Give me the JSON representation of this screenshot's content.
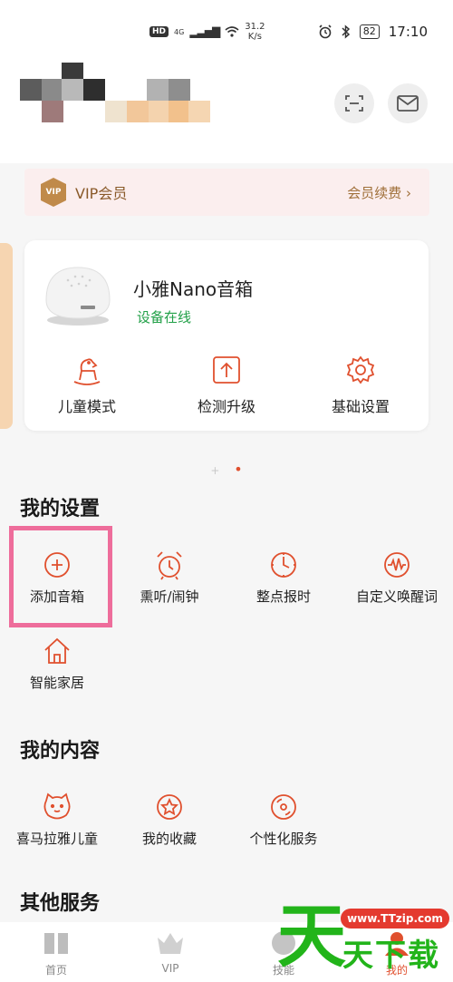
{
  "status_bar": {
    "hd": "HD",
    "network": "4G",
    "speed_value": "31.2",
    "speed_unit": "K/s",
    "battery": "82",
    "time": "17:10"
  },
  "header": {
    "scan_icon": "scan-icon",
    "mail_icon": "mail-icon"
  },
  "vip": {
    "badge": "VIP",
    "label": "VIP会员",
    "renew": "会员续费 ›"
  },
  "device": {
    "name": "小雅Nano音箱",
    "status": "设备在线",
    "actions": [
      {
        "label": "儿童模式",
        "icon": "rocking-horse-icon"
      },
      {
        "label": "检测升级",
        "icon": "upgrade-icon"
      },
      {
        "label": "基础设置",
        "icon": "gear-icon"
      }
    ]
  },
  "pager": {
    "plus": "+",
    "dot": "•"
  },
  "settings": {
    "title": "我的设置",
    "items": [
      {
        "label": "添加音箱",
        "icon": "plus-circle-icon"
      },
      {
        "label": "熏听/闹钟",
        "icon": "alarm-clock-icon"
      },
      {
        "label": "整点报时",
        "icon": "clock-icon"
      },
      {
        "label": "自定义唤醒词",
        "icon": "waveform-icon"
      },
      {
        "label": "智能家居",
        "icon": "home-icon"
      }
    ]
  },
  "content": {
    "title": "我的内容",
    "items": [
      {
        "label": "喜马拉雅儿童",
        "icon": "cat-face-icon"
      },
      {
        "label": "我的收藏",
        "icon": "star-circle-icon"
      },
      {
        "label": "个性化服务",
        "icon": "disc-icon"
      }
    ]
  },
  "other": {
    "title": "其他服务"
  },
  "tabs": [
    {
      "label": "首页",
      "icon": "book-icon"
    },
    {
      "label": "VIP",
      "icon": "crown-icon"
    },
    {
      "label": "技能",
      "icon": "skill-icon"
    },
    {
      "label": "我的",
      "icon": "user-icon"
    }
  ],
  "watermark": {
    "big": "天",
    "url": "www.TTzip.com",
    "small": "天下载"
  },
  "colors": {
    "accent": "#e0502e",
    "vip_gold": "#c08a4a",
    "online_green": "#22a048",
    "highlight_pink": "#ee6d9b"
  }
}
